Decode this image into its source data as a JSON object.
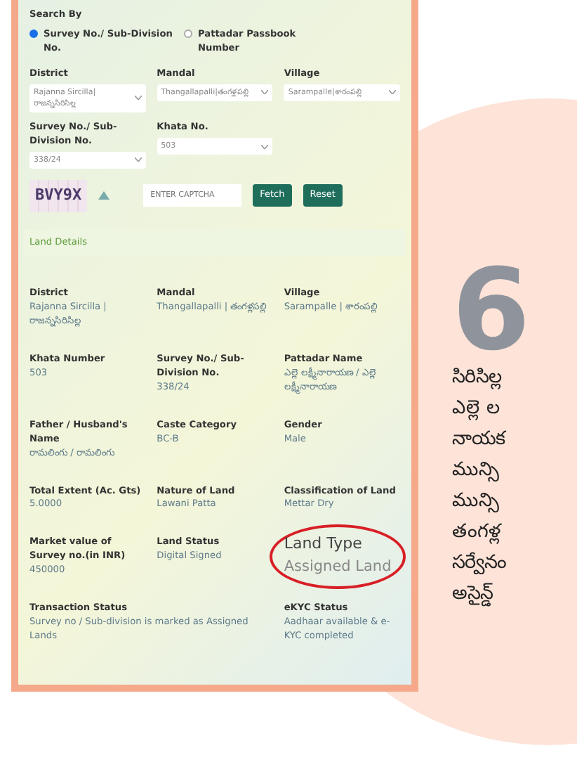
{
  "search_by": {
    "label": "Search By",
    "options": [
      {
        "label": "Survey No./ Sub-Division No.",
        "selected": true
      },
      {
        "label": "Pattadar Passbook Number",
        "selected": false
      }
    ]
  },
  "filters": [
    {
      "label": "District",
      "value": "Rajanna Sircilla|రాజన్నసిరిసిల్ల"
    },
    {
      "label": "Mandal",
      "value": "Thangallapalli|తంగళ్లపల్లి"
    },
    {
      "label": "Village",
      "value": "Sarampalle|శారంపల్లి"
    },
    {
      "label": "Survey No./ Sub-Division No.",
      "value": "338/24"
    },
    {
      "label": "Khata No.",
      "value": "503"
    }
  ],
  "captcha": {
    "text": "BVY9X",
    "placeholder": "ENTER CAPTCHA"
  },
  "buttons": [
    "Fetch",
    "Reset"
  ],
  "land_details": {
    "title": "Land Details",
    "fields": [
      {
        "label": "District",
        "value": "Rajanna Sircilla | రాజన్నసిరిసిల్ల",
        "kind": "plain"
      },
      {
        "label": "Mandal",
        "value": "Thangallapalli | తంగళ్లపల్లి",
        "kind": "plain"
      },
      {
        "label": "Village",
        "value": "Sarampalle | శారంపల్లి",
        "kind": "plain"
      },
      {
        "label": "Khata Number",
        "value": "503",
        "kind": "plain"
      },
      {
        "label": "Survey No./ Sub-Division No.",
        "value": "338/24",
        "kind": "plain"
      },
      {
        "label": "Pattadar Name",
        "value": "ఎల్లె లక్ష్మీనారాయణ / ఎల్లె లక్ష్మీనారాయణ",
        "kind": "plain"
      },
      {
        "label": "Father / Husband's Name",
        "value": "రామలింగు / రామలింగు",
        "kind": "plain"
      },
      {
        "label": "Caste Category",
        "value": "BC-B",
        "kind": "plain"
      },
      {
        "label": "Gender",
        "value": "Male",
        "kind": "plain"
      },
      {
        "label": "Total Extent (Ac. Gts)",
        "value": "5.0000",
        "kind": "plain"
      },
      {
        "label": "Nature of Land",
        "value": "Lawani Patta",
        "kind": "plain"
      },
      {
        "label": "Classification of Land",
        "value": "Mettar Dry",
        "kind": "plain"
      },
      {
        "label": "Market value of Survey no.(in INR)",
        "value": "450000",
        "kind": "plain"
      },
      {
        "label": "Land Status",
        "value": "Digital Signed",
        "kind": "plain"
      },
      {
        "label": "Land Type",
        "value": "Assigned Land",
        "kind": "circled"
      },
      {
        "label": "Transaction Status",
        "value": "Survey no / Sub-division is marked as Assigned Lands",
        "kind": "wide"
      },
      {
        "label": "eKYC Status",
        "value": "Aadhaar available & e-KYC completed",
        "kind": "plain"
      }
    ]
  },
  "article": {
    "number": "6",
    "lines": [
      "సిరిసిల్ల",
      "ఎల్లె ల",
      "నాయక",
      "మున్సి",
      "మున్సి",
      "తంగళ్ల",
      "సర్వేనం",
      "అసైన్డ్"
    ]
  }
}
